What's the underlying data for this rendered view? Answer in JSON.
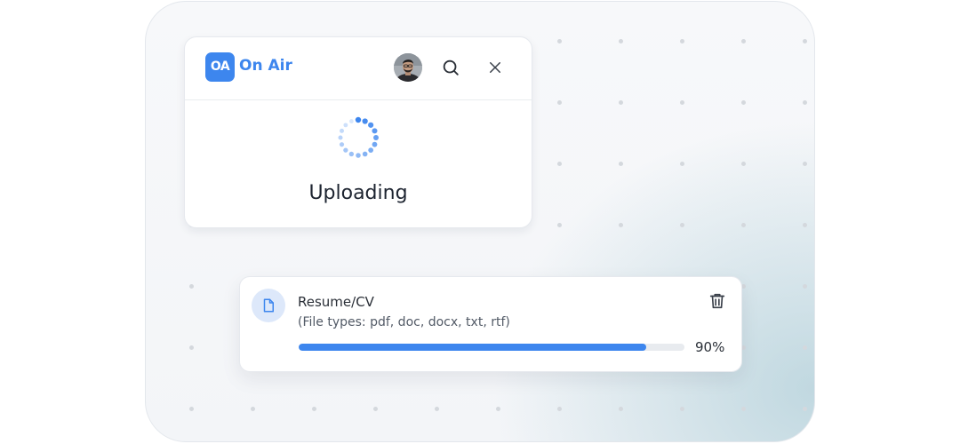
{
  "app": {
    "logo_text": "OA",
    "name": "On Air"
  },
  "upload_status": {
    "label": "Uploading"
  },
  "file_upload": {
    "title": "Resume/CV",
    "file_types": "(File types: pdf, doc, docx, txt, rtf)",
    "progress_value": 0.9,
    "progress_label": "90%"
  },
  "colors": {
    "accent": "#3d86ee",
    "track": "#e8ebef",
    "icon_bg": "#dde8fa"
  },
  "icons": {
    "search": "search-icon",
    "close": "close-icon",
    "file": "file-icon",
    "delete": "trash-icon",
    "spinner": "loading-spinner-icon"
  }
}
